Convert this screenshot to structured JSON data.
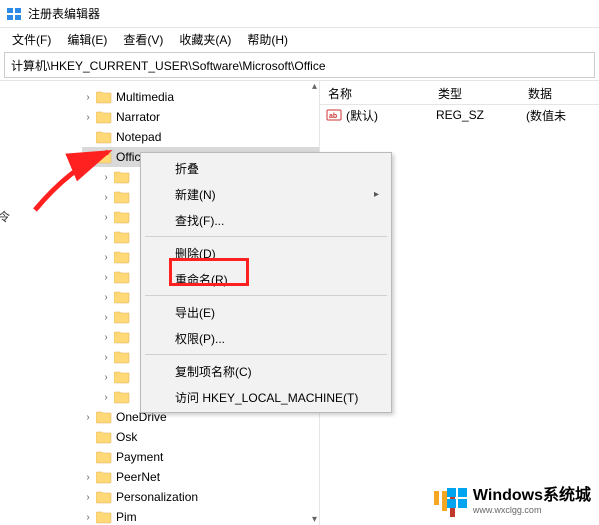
{
  "window": {
    "title": "注册表编辑器"
  },
  "menubar": {
    "file": "文件(F)",
    "edit": "编辑(E)",
    "view": "查看(V)",
    "favorites": "收藏夹(A)",
    "help": "帮助(H)"
  },
  "path": "计算机\\HKEY_CURRENT_USER\\Software\\Microsoft\\Office",
  "tree": {
    "items": [
      {
        "label": "Multimedia",
        "exp": "›"
      },
      {
        "label": "Narrator",
        "exp": "›"
      },
      {
        "label": "Notepad",
        "exp": ""
      },
      {
        "label": "Office",
        "exp": "⌄",
        "selected": true
      },
      {
        "label": "",
        "exp": "›",
        "indent": true
      },
      {
        "label": "",
        "exp": "›",
        "indent": true
      },
      {
        "label": "",
        "exp": "›",
        "indent": true
      },
      {
        "label": "",
        "exp": "›",
        "indent": true
      },
      {
        "label": "",
        "exp": "›",
        "indent": true
      },
      {
        "label": "",
        "exp": "›",
        "indent": true
      },
      {
        "label": "",
        "exp": "›",
        "indent": true
      },
      {
        "label": "",
        "exp": "›",
        "indent": true
      },
      {
        "label": "",
        "exp": "›",
        "indent": true
      },
      {
        "label": "",
        "exp": "›",
        "indent": true
      },
      {
        "label": "",
        "exp": "›",
        "indent": true
      },
      {
        "label": "",
        "exp": "›",
        "indent": true
      },
      {
        "label": "OneDrive",
        "exp": "›"
      },
      {
        "label": "Osk",
        "exp": ""
      },
      {
        "label": "Payment",
        "exp": ""
      },
      {
        "label": "PeerNet",
        "exp": "›"
      },
      {
        "label": "Personalization",
        "exp": "›"
      },
      {
        "label": "Pim",
        "exp": "›"
      }
    ]
  },
  "list": {
    "headers": {
      "name": "名称",
      "type": "类型",
      "data": "数据"
    },
    "rows": [
      {
        "name": "(默认)",
        "type": "REG_SZ",
        "data": "(数值未"
      }
    ]
  },
  "ctxmenu": {
    "collapse": "折叠",
    "new": "新建(N)",
    "find": "查找(F)...",
    "delete": "删除(D)",
    "rename": "重命名(R)",
    "export": "导出(E)",
    "permissions": "权限(P)...",
    "copykey": "复制项名称(C)",
    "goto": "访问 HKEY_LOCAL_MACHINE(T)"
  },
  "cut_label": "令",
  "watermark": {
    "text": "Windows系统城",
    "sub": "www.wxclgg.com"
  }
}
